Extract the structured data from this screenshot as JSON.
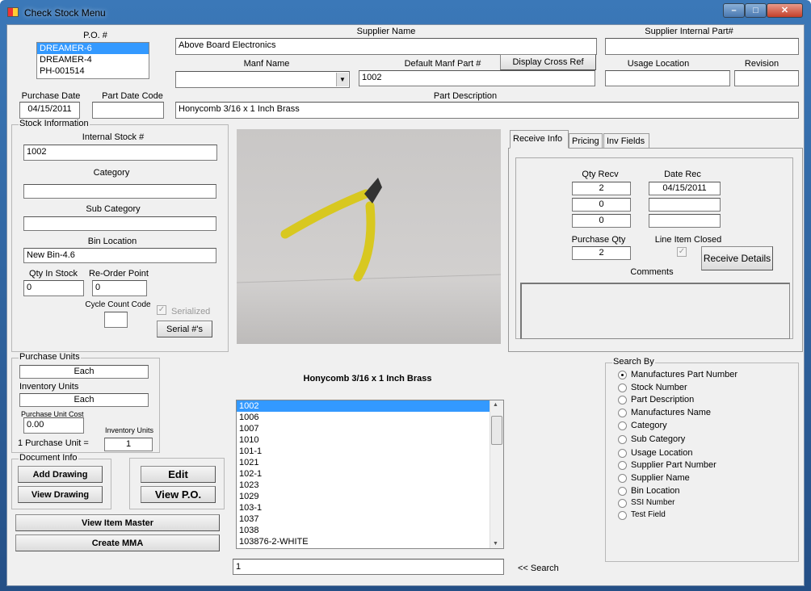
{
  "window": {
    "title": "Check Stock Menu"
  },
  "po": {
    "label": "P.O. #",
    "items": [
      "DREAMER-6",
      "DREAMER-4",
      "PH-001514"
    ],
    "selected": 0
  },
  "supplier_name": {
    "label": "Supplier Name",
    "value": "Above Board Electronics"
  },
  "supplier_internal_part": {
    "label": "Supplier Internal Part#",
    "value": ""
  },
  "manf_name": {
    "label": "Manf Name",
    "value": ""
  },
  "default_manf_part": {
    "label": "Default Manf Part #",
    "value": "1002"
  },
  "display_cross_ref": "Display Cross Ref",
  "usage_location": {
    "label": "Usage Location",
    "value": ""
  },
  "revision": {
    "label": "Revision",
    "value": ""
  },
  "purchase_date": {
    "label": "Purchase Date",
    "value": "04/15/2011"
  },
  "part_date_code": {
    "label": "Part Date Code",
    "value": ""
  },
  "part_description": {
    "label": "Part Description",
    "value": "Honycomb 3/16 x 1 Inch Brass"
  },
  "stock": {
    "group": "Stock Information",
    "internal_stock_label": "Internal Stock #",
    "internal_stock": "1002",
    "category_label": "Category",
    "category": "",
    "sub_category_label": "Sub Category",
    "sub_category": "",
    "bin_label": "Bin Location",
    "bin": "New Bin-4.6",
    "qty_label": "Qty In Stock",
    "qty": "0",
    "reorder_label": "Re-Order Point",
    "reorder": "0",
    "cycle_label": "Cycle Count Code",
    "cycle": "",
    "serialized_label": "Serialized",
    "serialized": true,
    "serial_button": "Serial #'s"
  },
  "tabs": [
    {
      "label": "Receive Info",
      "active": true
    },
    {
      "label": "Pricing"
    },
    {
      "label": "Inv Fields"
    }
  ],
  "receive": {
    "qty_recv_label": "Qty Recv",
    "qty_recv": [
      "2",
      "0",
      "0"
    ],
    "date_rec_label": "Date Rec",
    "date_rec": [
      "04/15/2011",
      "",
      ""
    ],
    "purchase_qty_label": "Purchase Qty",
    "purchase_qty": "2",
    "line_closed_label": "Line Item Closed",
    "line_closed": true,
    "receive_details": "Receive Details",
    "comments_label": "Comments",
    "comments": ""
  },
  "product_caption": "Honycomb 3/16 x 1 Inch Brass",
  "units": {
    "group": "Purchase Units",
    "purchase_units": "Each",
    "inventory_label": "Inventory Units",
    "inventory_units": "Each",
    "cost_label": "Purchase Unit Cost",
    "cost": "0.00",
    "inv_units_small_label": "Inventory Units",
    "conversion_label": "1 Purchase Unit =",
    "conversion": "1"
  },
  "document": {
    "group": "Document Info",
    "add_drawing": "Add Drawing",
    "view_drawing": "View Drawing"
  },
  "actions": {
    "edit": "Edit",
    "view_po": "View P.O.",
    "view_item_master": "View Item Master",
    "create_mma": "Create MMA"
  },
  "parts_list": {
    "items": [
      "1002",
      "1006",
      "1007",
      "1010",
      "101-1",
      "1021",
      "102-1",
      "1023",
      "1029",
      "103-1",
      "1037",
      "1038",
      "103876-2-WHITE"
    ],
    "selected": 0
  },
  "search": {
    "value": "1",
    "label": "<< Search"
  },
  "search_by": {
    "group": "Search By",
    "options": [
      "Manufactures Part Number",
      "Stock Number",
      "Part Description",
      "Manufactures Name",
      "Category",
      "Sub Category",
      "Usage Location",
      "Supplier Part Number",
      "Supplier Name",
      "Bin Location",
      "SSI Number",
      "Test Field"
    ],
    "selected": 0
  }
}
